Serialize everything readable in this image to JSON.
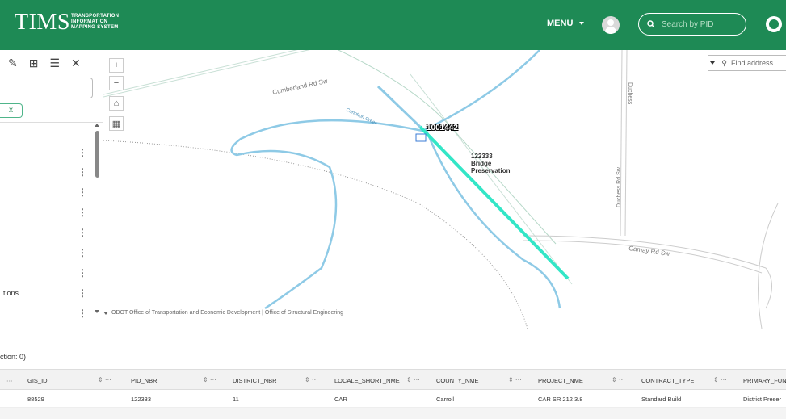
{
  "header": {
    "logo": "TIMS",
    "logo_sub_1": "TRANSPORTATION",
    "logo_sub_2": "INFORMATION",
    "logo_sub_3": "MAPPING SYSTEM",
    "menu_label": "MENU",
    "search_placeholder": "Search by PID",
    "colors": {
      "header_bg": "#1e8a55"
    }
  },
  "left_panel": {
    "tool_icons": [
      "pencil-icon",
      "add-layer-icon",
      "list-icon",
      "close-icon"
    ],
    "chip_label": "x",
    "partial_label": "tions"
  },
  "map": {
    "zoom_in": "+",
    "zoom_out": "−",
    "find_address_placeholder": "Find address",
    "attribution": "ODOT Office of Transportation and Economic Development | Office of Structural Engineering",
    "pid_label": "1001442",
    "project_label_1": "122333",
    "project_label_2": "Bridge",
    "project_label_3": "Preservation",
    "road_labels": {
      "cumberland": "Cumberland Rd Sw",
      "camay": "Camay Rd Sw",
      "duchess_1": "Duchess",
      "duchess_2": "Duchess Rd Sw",
      "creek": "Conotton Creek"
    },
    "colors": {
      "river": "#8ecae6",
      "highlight": "#33e6c7"
    }
  },
  "selection": {
    "text": "ction: 0)"
  },
  "table": {
    "columns": [
      "GIS_ID",
      "PID_NBR",
      "DISTRICT_NBR",
      "LOCALE_SHORT_NME",
      "COUNTY_NME",
      "PROJECT_NME",
      "CONTRACT_TYPE",
      "PRIMARY_FUN"
    ],
    "row": [
      "88529",
      "122333",
      "11",
      "CAR",
      "Carroll",
      "CAR SR 212 3.8",
      "Standard Build",
      "District Preser"
    ]
  }
}
